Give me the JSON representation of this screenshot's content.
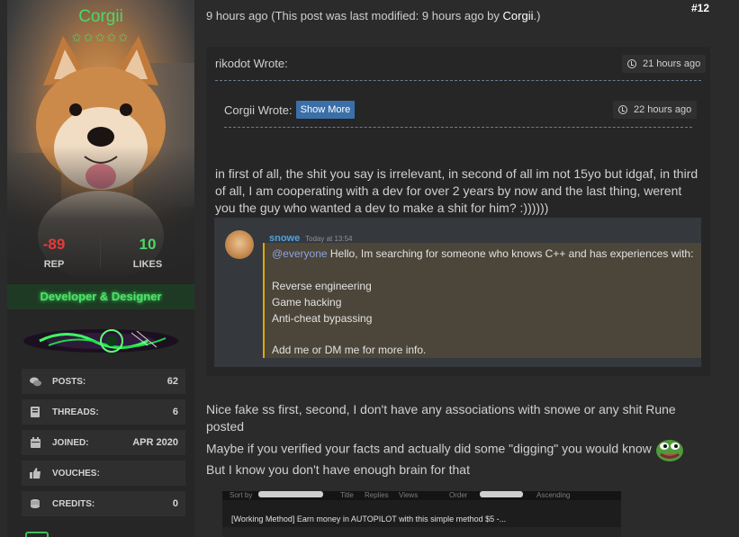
{
  "author": {
    "username": "Corgii",
    "stars": "✩✩✩✩✩",
    "reputation": {
      "value": "-89",
      "label": "REP"
    },
    "likes": {
      "value": "10",
      "label": "LIKES"
    },
    "usergroup": "Developer & Designer",
    "info": [
      {
        "icon": "comments-icon",
        "label": "POSTS:",
        "value": "62"
      },
      {
        "icon": "book-icon",
        "label": "THREADS:",
        "value": "6"
      },
      {
        "icon": "calendar-icon",
        "label": "JOINED:",
        "value": "APR 2020"
      },
      {
        "icon": "thumbs-up-icon",
        "label": "VOUCHES:",
        "value": ""
      },
      {
        "icon": "coins-icon",
        "label": "CREDITS:",
        "value": "0"
      }
    ]
  },
  "post": {
    "number": "#12",
    "meta_prefix": "9 hours ago (This post was last modified: 9 hours ago by ",
    "meta_author": "Corgii",
    "meta_suffix": ".)",
    "outer_quote": {
      "author": "rikodot Wrote:",
      "time": "21 hours ago",
      "text": "in first of all, the shit you say is irrelevant, in second of all im not 15yo but idgaf, in third of all, I am cooperating with a dev for over 2 years by now and the last thing, werent you the guy who wanted a dev to make a shit for him? :))))))"
    },
    "inner_quote": {
      "author": "Corgii Wrote:",
      "show_more": "Show More",
      "time": "22 hours ago"
    },
    "embed": {
      "name": "snowe",
      "time": "Today at 13:54",
      "mention": "@everyone",
      "lines": [
        " Hello, Im searching for someone who knows C++ and has experiences with:",
        "Reverse engineering",
        "Game hacking",
        "Anti-cheat bypassing",
        "Add me or DM me for more info."
      ]
    },
    "reply": [
      "Nice fake ss first, second, I don't have any associations with snowe or any shit Rune",
      "posted",
      "Maybe if you verified your facts and actually did some \"digging\" you would know",
      "But I know you don't have enough brain for that"
    ],
    "thumbnail": {
      "sort_by": "Sort by",
      "col1": "Title",
      "col2": "Replies",
      "col3": "Views",
      "order": "Order",
      "ascending": "Ascending",
      "thread_title": "[Working Method] Earn money in AUTOPILOT with this simple method $5 -..."
    }
  }
}
